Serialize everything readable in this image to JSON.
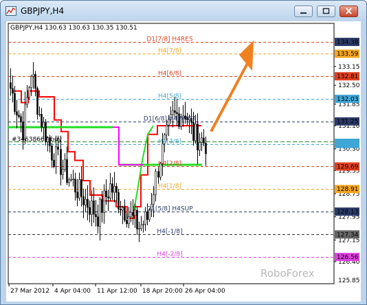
{
  "window": {
    "title": "GBPJPY,H4"
  },
  "chart_data": {
    "type": "candlestick",
    "symbol_info": "GBPJPY,H4  130.63 130.63 130.35 130.51",
    "ylim": [
      125.85,
      134.38
    ],
    "y_ticks": [
      "134.38",
      "133.59",
      "132.81",
      "132.03",
      "131.25",
      "130.47",
      "129.69",
      "128.91",
      "128.13",
      "127.34",
      "126.56",
      "125.85"
    ],
    "y_tick_values": [
      134.38,
      133.59,
      132.81,
      132.03,
      131.25,
      130.47,
      129.69,
      128.91,
      128.13,
      127.34,
      126.56,
      125.85
    ],
    "extra_price_labels": [
      "133.15",
      "132.50",
      "131.85",
      "131.10",
      "130.30",
      "129.55",
      "128.75",
      "127.95",
      "127.15",
      "126.40",
      "125.85"
    ],
    "extra_price_values": [
      133.15,
      132.5,
      131.85,
      131.1,
      130.3,
      129.55,
      128.75,
      127.95,
      127.15,
      126.4
    ],
    "x_labels": [
      "27 Mar 2012",
      "4 Apr 04:00",
      "11 Apr 12:00",
      "18 Apr 20:00",
      "26 Apr 04:00"
    ],
    "levels": [
      {
        "label": "D1[7/8] H4RES",
        "price": 134.0,
        "color": "#e04020",
        "tag": "134.38",
        "tag_color": "#2b3a67"
      },
      {
        "label": "H4[7/8]",
        "price": 133.59,
        "color": "#f5a623",
        "tag": "133.59",
        "tag_color": "#f5a623"
      },
      {
        "label": "H4[6/8]",
        "price": 132.81,
        "color": "#e04020",
        "tag": "132.81",
        "tag_color": "#e04020"
      },
      {
        "label": "H4[5/8]",
        "price": 132.03,
        "color": "#3fa7d6",
        "tag": "132.03",
        "tag_color": "#3fa7d6"
      },
      {
        "label": "D1[6/8] H4PIVOT",
        "price": 131.25,
        "color": "#2b3a67",
        "tag": "131.25",
        "tag_color": "#2b3a67"
      },
      {
        "label": "H4[3/8]",
        "price": 130.47,
        "color": "#3fa7d6",
        "tag": "130.47",
        "tag_color": "#3fa7d6"
      },
      {
        "label": "H4[2/8]",
        "price": 129.69,
        "color": "#e04020",
        "tag": "129.69",
        "tag_color": "#e04020"
      },
      {
        "label": "H4[1/8]",
        "price": 128.91,
        "color": "#f5a623",
        "tag": "128.91",
        "tag_color": "#f5a623"
      },
      {
        "label": "D1[5/8] H4SUP",
        "price": 128.13,
        "color": "#2b3a67",
        "tag": "128.13",
        "tag_color": "#2b3a67"
      },
      {
        "label": "H4[-1/8]",
        "price": 127.34,
        "color": "#333333",
        "tag": "127.34",
        "tag_color": "#666666"
      },
      {
        "label": "H4[-2/8]",
        "price": 126.56,
        "color": "#e040e0",
        "tag": "126.56",
        "tag_color": "#e040e0"
      }
    ],
    "order_label": "#34638667 buy",
    "current_price": 130.51,
    "watermark": "RoboForex",
    "colors": {
      "candle": "#000000",
      "red_line": "#ff0000",
      "green_line": "#22dd22",
      "magenta_line": "#ff00ff",
      "arrow": "#f08020"
    }
  }
}
